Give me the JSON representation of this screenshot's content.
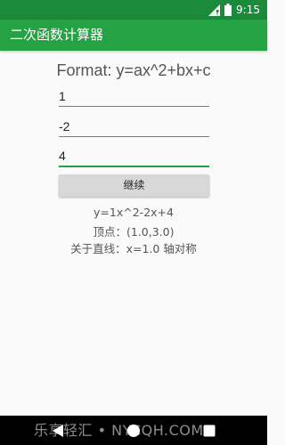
{
  "status_bar": {
    "time": "9:15",
    "icons": [
      "signal-icon",
      "battery-icon"
    ]
  },
  "app_bar": {
    "title": "二次函数计算器"
  },
  "main": {
    "format": "Format: y=ax^2+bx+c",
    "inputs": {
      "a": "1",
      "b": "-2",
      "c": "4"
    },
    "continue_label": "继续",
    "result_equation": "y=1x^2-2x+4",
    "result_vertex": "顶点：(1.0,3.0)",
    "result_axis": "关于直线：x=1.0 轴对称"
  },
  "nav_bar": {
    "buttons": [
      "back-icon",
      "home-icon",
      "recent-apps-icon"
    ]
  },
  "watermark": "乐享轻汇 • NYCQH.COM",
  "colors": {
    "status_bar": "#1b8a3a",
    "app_bar": "#25a244",
    "accent": "#23a043",
    "button": "#d8d8d8"
  }
}
